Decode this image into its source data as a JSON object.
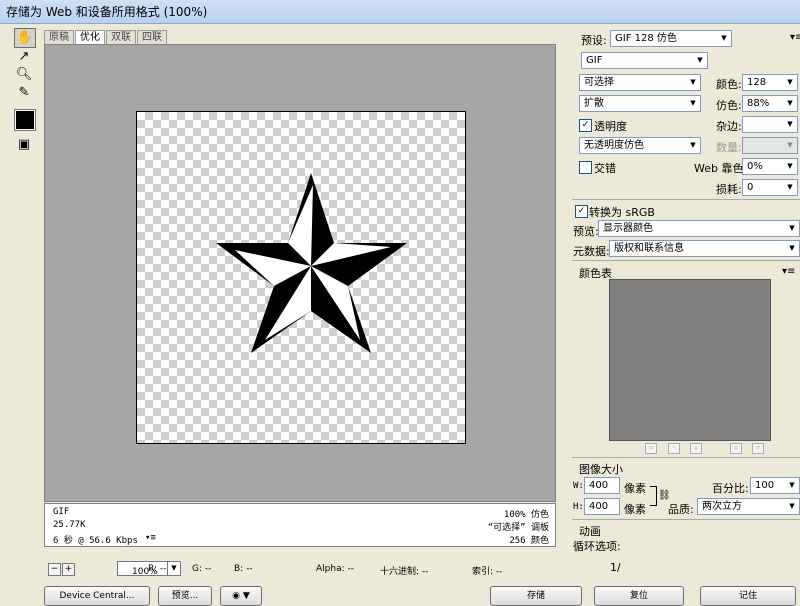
{
  "window": {
    "title": "存储为 Web 和设备所用格式 (100%)"
  },
  "tabs": [
    {
      "label": "原稿",
      "active": false
    },
    {
      "label": "优化",
      "active": true
    },
    {
      "label": "双联",
      "active": false
    },
    {
      "label": "四联",
      "active": false
    }
  ],
  "tools": [
    "hand-icon",
    "slice-select-icon",
    "zoom-icon",
    "eyedropper-icon"
  ],
  "eyedropper_color": "#000000",
  "info": {
    "format": "GIF",
    "size": "25.77K",
    "time": "6 秒 @ 56.6 Kbps",
    "dither": "100% 仿色",
    "palette": "“可选择” 调板",
    "colors": "256 颜色"
  },
  "statusbar": {
    "zoom": "100%",
    "r": "R: --",
    "g": "G: --",
    "b": "B: --",
    "alpha": "Alpha: --",
    "hex": "十六进制: --",
    "index": "索引: --"
  },
  "buttons": {
    "device_central": "Device Central...",
    "preview": "预览...",
    "save": "存储",
    "reset": "复位",
    "remember": "记住"
  },
  "settings": {
    "preset_label": "预设:",
    "preset_value": "GIF 128 仿色",
    "format_value": "GIF",
    "reduction_value": "可选择",
    "colors_label": "颜色:",
    "colors_value": "128",
    "dither_algo_value": "扩散",
    "dither_label": "仿色:",
    "dither_value": "88%",
    "transparency_label": "透明度",
    "transparency_checked": true,
    "matte_label": "杂边:",
    "matte_value": "",
    "trans_dither_value": "无透明度仿色",
    "amount_label": "数量:",
    "interlaced_label": "交错",
    "interlaced_checked": false,
    "web_snap_label": "Web 靠色:",
    "web_snap_value": "0%",
    "lossy_label": "损耗:",
    "lossy_value": "0",
    "convert_srgb_label": "转换为 sRGB",
    "convert_srgb_checked": true,
    "preview_label": "预览:",
    "preview_value": "显示器颜色",
    "metadata_label": "元数据:",
    "metadata_value": "版权和联系信息"
  },
  "color_table": {
    "title": "颜色表",
    "color": "#808080"
  },
  "image_size": {
    "title": "图像大小",
    "w_label": "W:",
    "w_value": "400",
    "h_label": "H:",
    "h_value": "400",
    "unit": "像素",
    "percent_label": "百分比:",
    "percent_value": "100",
    "quality_label": "品质:",
    "quality_value": "两次立方"
  },
  "animation": {
    "title": "动画",
    "loop_label": "循环选项:",
    "frame": "1/"
  }
}
